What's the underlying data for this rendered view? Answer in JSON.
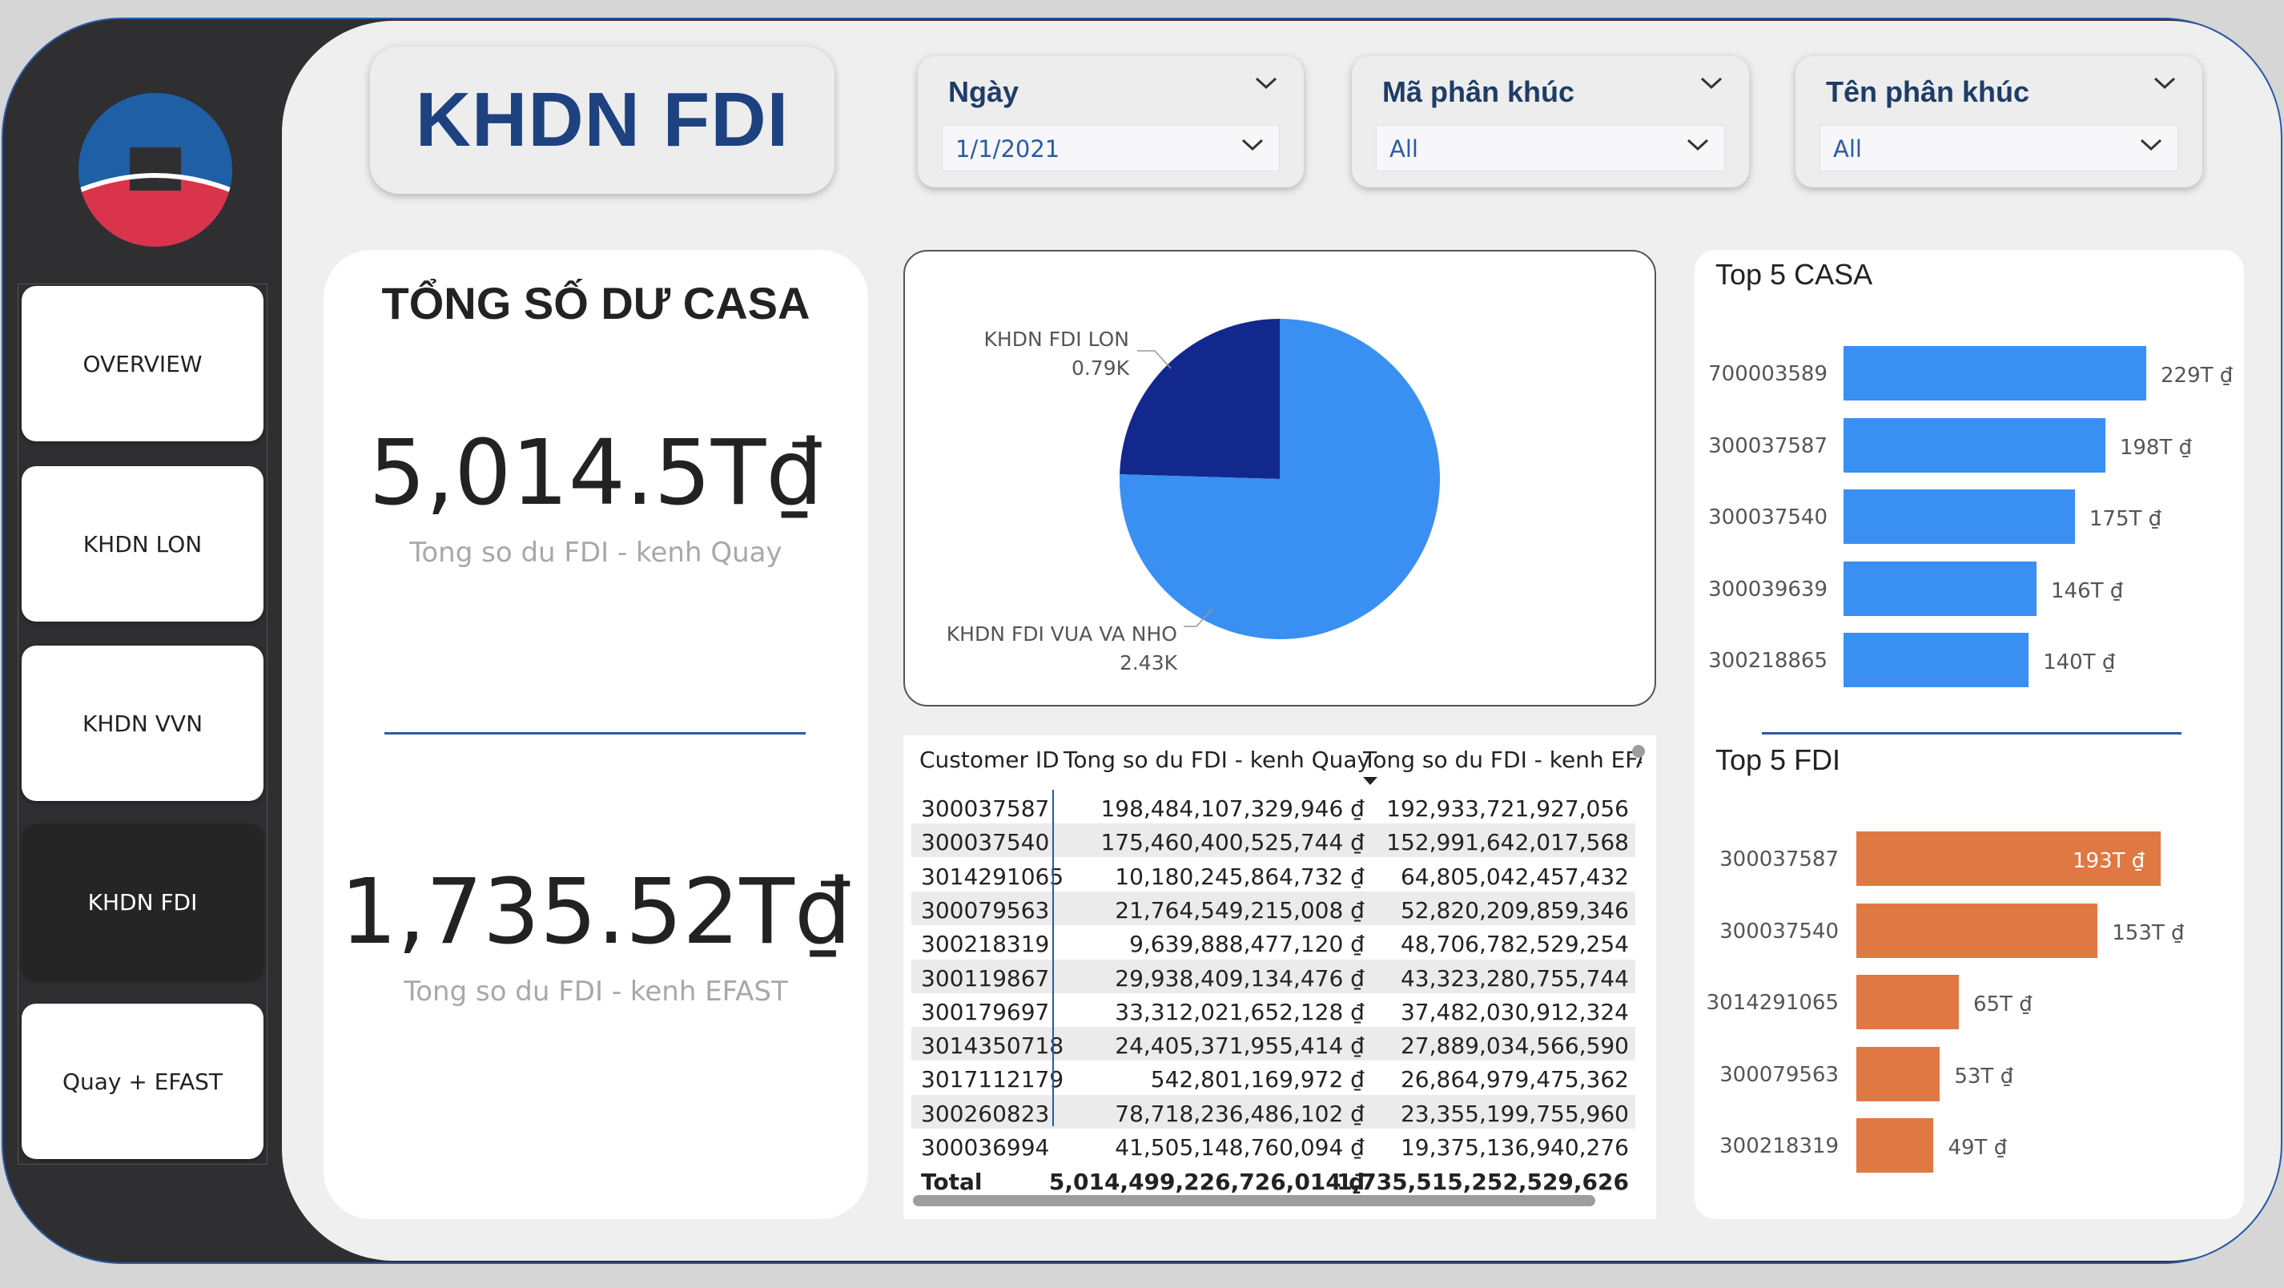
{
  "sidebar": {
    "items": [
      {
        "label": "OVERVIEW"
      },
      {
        "label": "KHDN LON"
      },
      {
        "label": "KHDN VVN"
      },
      {
        "label": "KHDN FDI"
      },
      {
        "label": "Quay + EFAST"
      }
    ]
  },
  "header": {
    "title": "KHDN FDI",
    "slicers": [
      {
        "label": "Ngày",
        "value": "1/1/2021"
      },
      {
        "label": "Mã phân khúc",
        "value": "All"
      },
      {
        "label": "Tên phân khúc",
        "value": "All"
      }
    ]
  },
  "kpi": {
    "heading": "TỔNG SỐ DƯ CASA",
    "quay_value": "5,014.5T₫",
    "quay_label": "Tong so du FDI - kenh Quay",
    "efast_value": "1,735.52T₫",
    "efast_label": "Tong so du FDI - kenh EFAST"
  },
  "colors": {
    "accent": "#2b5aa8",
    "title": "#1e4280",
    "casa_bar": "#3a8ff2",
    "fdi_bar": "#e07843",
    "pie_large": "#3a8ff2",
    "pie_small": "#13288d"
  },
  "table": {
    "headers": [
      "Customer ID",
      "Tong so du FDI - kenh Quay",
      "Tong so du FDI - kenh EFAST"
    ],
    "rows": [
      [
        "300037587",
        "198,484,107,329,946 ₫",
        "192,933,721,927,056"
      ],
      [
        "300037540",
        "175,460,400,525,744 ₫",
        "152,991,642,017,568"
      ],
      [
        "3014291065",
        "10,180,245,864,732 ₫",
        "64,805,042,457,432"
      ],
      [
        "300079563",
        "21,764,549,215,008 ₫",
        "52,820,209,859,346"
      ],
      [
        "300218319",
        "9,639,888,477,120 ₫",
        "48,706,782,529,254"
      ],
      [
        "300119867",
        "29,938,409,134,476 ₫",
        "43,323,280,755,744"
      ],
      [
        "300179697",
        "33,312,021,652,128 ₫",
        "37,482,030,912,324"
      ],
      [
        "3014350718",
        "24,405,371,955,414 ₫",
        "27,889,034,566,590"
      ],
      [
        "3017112179",
        "542,801,169,972 ₫",
        "26,864,979,475,362"
      ],
      [
        "300260823",
        "78,718,236,486,102 ₫",
        "23,355,199,755,960"
      ],
      [
        "300036994",
        "41,505,148,760,094 ₫",
        "19,375,136,940,276"
      ]
    ],
    "total": [
      "Total",
      "5,014,499,226,726,014 ₫",
      "1,735,515,252,529,626"
    ]
  },
  "chart_data": [
    {
      "type": "pie",
      "categories": [
        "KHDN FDI LON",
        "KHDN FDI VUA VA NHO"
      ],
      "values": [
        0.79,
        2.43
      ],
      "data_labels": [
        "0.79K",
        "2.43K"
      ]
    },
    {
      "type": "bar",
      "title": "Top 5 CASA",
      "categories": [
        "700003589",
        "300037587",
        "300037540",
        "300039639",
        "300218865"
      ],
      "values": [
        229,
        198,
        175,
        146,
        140
      ],
      "data_labels": [
        "229T ₫",
        "198T ₫",
        "175T ₫",
        "146T ₫",
        "140T ₫"
      ]
    },
    {
      "type": "bar",
      "title": "Top 5 FDI",
      "categories": [
        "300037587",
        "300037540",
        "3014291065",
        "300079563",
        "300218319"
      ],
      "values": [
        193,
        153,
        65,
        53,
        49
      ],
      "data_labels": [
        "193T ₫",
        "153T ₫",
        "65T ₫",
        "53T ₫",
        "49T ₫"
      ]
    }
  ]
}
